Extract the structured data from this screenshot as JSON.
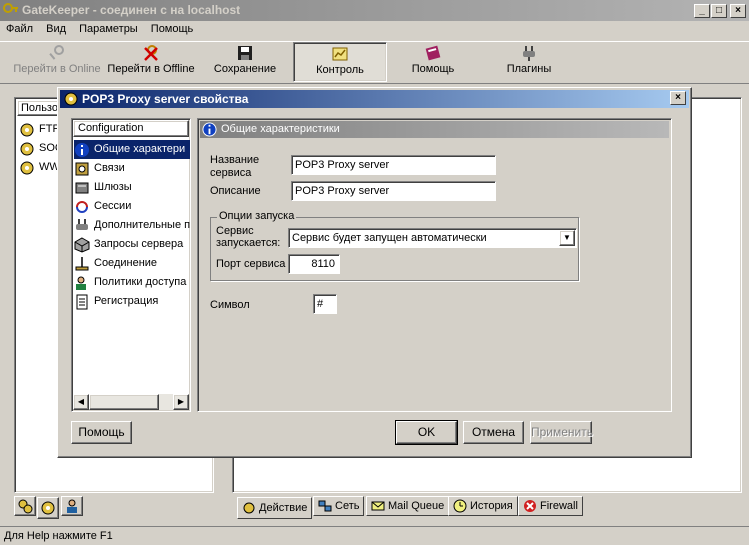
{
  "main_window": {
    "title": "GateKeeper - соединен с на localhost",
    "menu": [
      "Файл",
      "Вид",
      "Параметры",
      "Помощь"
    ],
    "toolbar": [
      {
        "label": "Перейти в Online",
        "icon": "key-icon",
        "enabled": false
      },
      {
        "label": "Перейти в Offline",
        "icon": "key-x-icon",
        "enabled": true
      },
      {
        "label": "Сохранение",
        "icon": "floppy-icon",
        "enabled": true
      },
      {
        "label": "Контроль",
        "icon": "control-icon",
        "enabled": true,
        "pressed": true
      },
      {
        "label": "Помощь",
        "icon": "help-book-icon",
        "enabled": true
      },
      {
        "label": "Плагины",
        "icon": "plugin-icon",
        "enabled": true
      }
    ],
    "left_panel": {
      "header": "Пользо",
      "items": [
        "FTP",
        "SOC",
        "WW"
      ]
    },
    "bottom_tabs": [
      "Действие",
      "Сеть",
      "Mail Queue",
      "История",
      "Firewall"
    ],
    "status_bar": "Для Help нажмите F1"
  },
  "dialog": {
    "title": "POP3 Proxy server свойства",
    "tree_header": "Configuration",
    "tree_items": [
      "Общие характери",
      "Связи",
      "Шлюзы",
      "Сессии",
      "Дополнительные п",
      "Запросы сервера",
      "Соединение",
      "Политики доступа",
      "Регистрация"
    ],
    "selected_index": 0,
    "panel_header": "Общие характеристики",
    "fields": {
      "name_label": "Название сервиса",
      "name_value": "POP3 Proxy server",
      "desc_label": "Описание",
      "desc_value": "POP3 Proxy server",
      "group_title": "Опции запуска",
      "startup_label": "Сервис запускается:",
      "startup_value": "Сервис будет запущен автоматически",
      "port_label": "Порт сервиса",
      "port_value": "8110",
      "symbol_label": "Символ",
      "symbol_value": "#"
    },
    "buttons": {
      "help": "Помощь",
      "ok": "OK",
      "cancel": "Отмена",
      "apply": "Применить"
    }
  }
}
